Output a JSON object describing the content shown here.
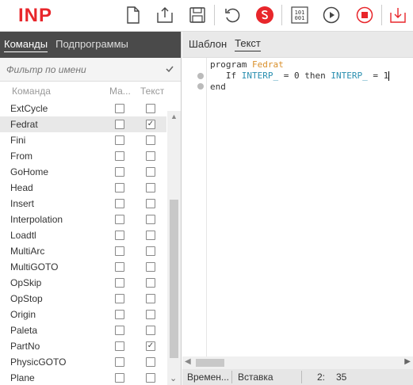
{
  "app": {
    "logo": "INP"
  },
  "toolbar": {
    "buttons": [
      "new-file-icon",
      "open-export-icon",
      "save-icon",
      "undo-icon",
      "stop-run-icon",
      "binary-icon",
      "play-icon",
      "stop-icon",
      "import-icon"
    ],
    "colors": {
      "accent": "#e8262b"
    }
  },
  "left": {
    "tabs": [
      "Команды",
      "Подпрограммы"
    ],
    "filter_placeholder": "Фильтр по имени",
    "columns": {
      "name": "Команда",
      "ma": "Ма...",
      "text": "Текст"
    },
    "rows": [
      {
        "name": "ExtCycle",
        "ma": false,
        "text": false
      },
      {
        "name": "Fedrat",
        "ma": false,
        "text": true,
        "selected": true
      },
      {
        "name": "Fini",
        "ma": false,
        "text": false
      },
      {
        "name": "From",
        "ma": false,
        "text": false
      },
      {
        "name": "GoHome",
        "ma": false,
        "text": false
      },
      {
        "name": "Head",
        "ma": false,
        "text": false
      },
      {
        "name": "Insert",
        "ma": false,
        "text": false
      },
      {
        "name": "Interpolation",
        "ma": false,
        "text": false
      },
      {
        "name": "Loadtl",
        "ma": false,
        "text": false
      },
      {
        "name": "MultiArc",
        "ma": false,
        "text": false
      },
      {
        "name": "MultiGOTO",
        "ma": false,
        "text": false
      },
      {
        "name": "OpSkip",
        "ma": false,
        "text": false
      },
      {
        "name": "OpStop",
        "ma": false,
        "text": false
      },
      {
        "name": "Origin",
        "ma": false,
        "text": false
      },
      {
        "name": "Paleta",
        "ma": false,
        "text": false
      },
      {
        "name": "PartNo",
        "ma": false,
        "text": true
      },
      {
        "name": "PhysicGOTO",
        "ma": false,
        "text": false
      },
      {
        "name": "Plane",
        "ma": false,
        "text": false
      }
    ]
  },
  "right": {
    "tabs": [
      "Шаблон",
      "Текст"
    ],
    "code": {
      "line1_kw": "program",
      "line1_name": "Fedrat",
      "line2_if": "If",
      "line2_var1": "INTERP_",
      "line2_mid": "= 0 then",
      "line2_var2": "INTERP_",
      "line2_end": "= 1",
      "line3": "end"
    },
    "status": {
      "label": "Времен...",
      "mode": "Вставка",
      "line": "2:",
      "col": "35"
    }
  }
}
